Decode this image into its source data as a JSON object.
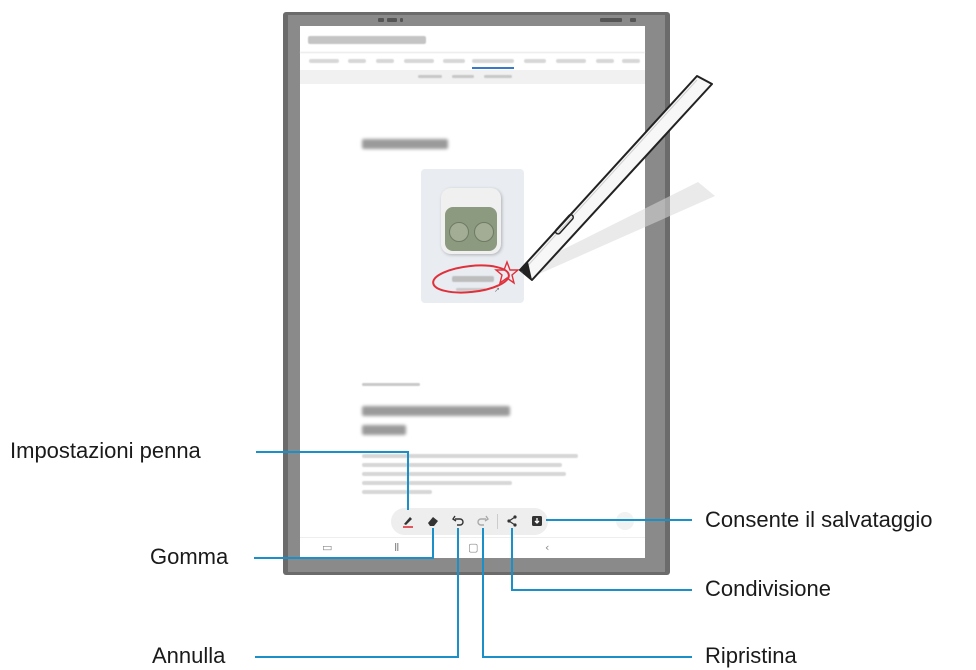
{
  "labels": {
    "pen_settings": "Impostazioni penna",
    "eraser": "Gomma",
    "undo": "Annulla",
    "redo": "Ripristina",
    "share": "Condivisione",
    "save": "Consente il salvataggio"
  },
  "toolbar": {
    "icons": [
      "pen-icon",
      "eraser-icon",
      "undo-icon",
      "redo-icon",
      "share-icon",
      "save-icon"
    ]
  },
  "colors": {
    "callout_line": "#1a8fc8",
    "annotation": "#e0303a",
    "bezel": "#6b6b6b"
  }
}
